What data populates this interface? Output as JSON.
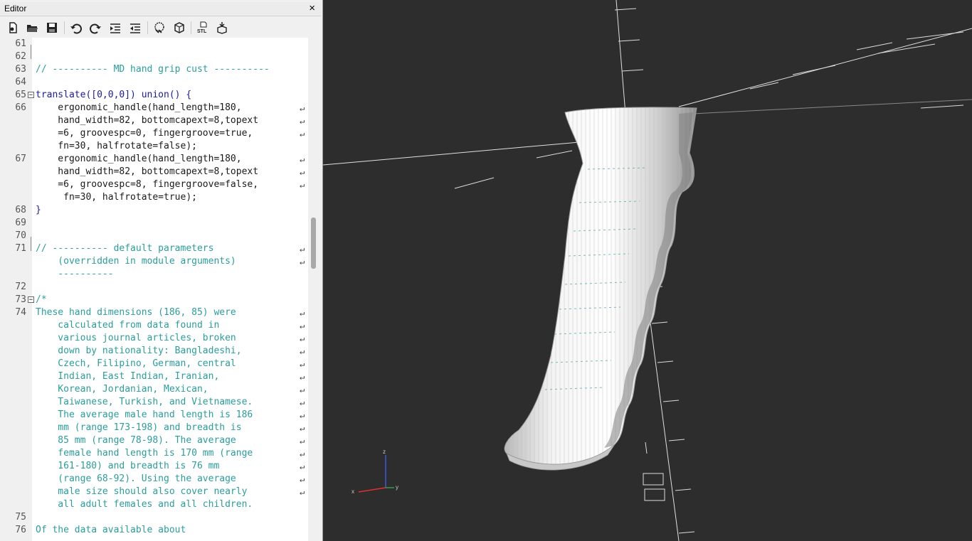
{
  "editor": {
    "title": "Editor",
    "close_label": "×",
    "toolbar": [
      "new-file-icon",
      "open-file-icon",
      "save-icon",
      "undo-icon",
      "redo-icon",
      "indent-icon",
      "unindent-icon",
      "preview-icon",
      "render-icon",
      "export-stl-icon",
      "send-to-print-icon"
    ],
    "stl_label": "STL"
  },
  "code_lines": [
    {
      "n": "61",
      "t": ""
    },
    {
      "n": "62",
      "t": ""
    },
    {
      "n": "63",
      "t": "// ---------- MD hand grip cust ----------"
    },
    {
      "n": "64",
      "t": ""
    },
    {
      "n": "65",
      "t": "translate([0,0,0]) union() {"
    },
    {
      "n": "66",
      "t": "    ergonomic_handle(hand_length=180,"
    },
    {
      "n": "",
      "t": "    hand_width=82, bottomcapext=8,topext"
    },
    {
      "n": "",
      "t": "    =6, groovespc=0, fingergroove=true,"
    },
    {
      "n": "",
      "t": "    fn=30, halfrotate=false);"
    },
    {
      "n": "67",
      "t": "    ergonomic_handle(hand_length=180,"
    },
    {
      "n": "",
      "t": "    hand_width=82, bottomcapext=8,topext"
    },
    {
      "n": "",
      "t": "    =6, groovespc=8, fingergroove=false,"
    },
    {
      "n": "",
      "t": "     fn=30, halfrotate=true);"
    },
    {
      "n": "68",
      "t": "}"
    },
    {
      "n": "69",
      "t": ""
    },
    {
      "n": "70",
      "t": ""
    },
    {
      "n": "71",
      "t": "// ---------- default parameters"
    },
    {
      "n": "",
      "t": "    (overridden in module arguments)"
    },
    {
      "n": "",
      "t": "    ----------"
    },
    {
      "n": "72",
      "t": ""
    },
    {
      "n": "73",
      "t": "/*"
    },
    {
      "n": "74",
      "t": "These hand dimensions (186, 85) were"
    },
    {
      "n": "",
      "t": "    calculated from data found in"
    },
    {
      "n": "",
      "t": "    various journal articles, broken"
    },
    {
      "n": "",
      "t": "    down by nationality: Bangladeshi,"
    },
    {
      "n": "",
      "t": "    Czech, Filipino, German, central"
    },
    {
      "n": "",
      "t": "    Indian, East Indian, Iranian,"
    },
    {
      "n": "",
      "t": "    Korean, Jordanian, Mexican,"
    },
    {
      "n": "",
      "t": "    Taiwanese, Turkish, and Vietnamese."
    },
    {
      "n": "",
      "t": "    The average male hand length is 186"
    },
    {
      "n": "",
      "t": "    mm (range 173-198) and breadth is"
    },
    {
      "n": "",
      "t": "    85 mm (range 78-98). The average"
    },
    {
      "n": "",
      "t": "    female hand length is 170 mm (range"
    },
    {
      "n": "",
      "t": "    161-180) and breadth is 76 mm"
    },
    {
      "n": "",
      "t": "    (range 68-92). Using the average"
    },
    {
      "n": "",
      "t": "    male size should also cover nearly"
    },
    {
      "n": "",
      "t": "    all adult females and all children."
    },
    {
      "n": "75",
      "t": ""
    },
    {
      "n": "76",
      "t": "Of the data available about"
    }
  ],
  "viewport": {
    "axis_labels": {
      "x": "x",
      "y": "y",
      "z": "z"
    },
    "colors": {
      "background": "#2d2d2d",
      "model": "#e6e6e6"
    }
  }
}
